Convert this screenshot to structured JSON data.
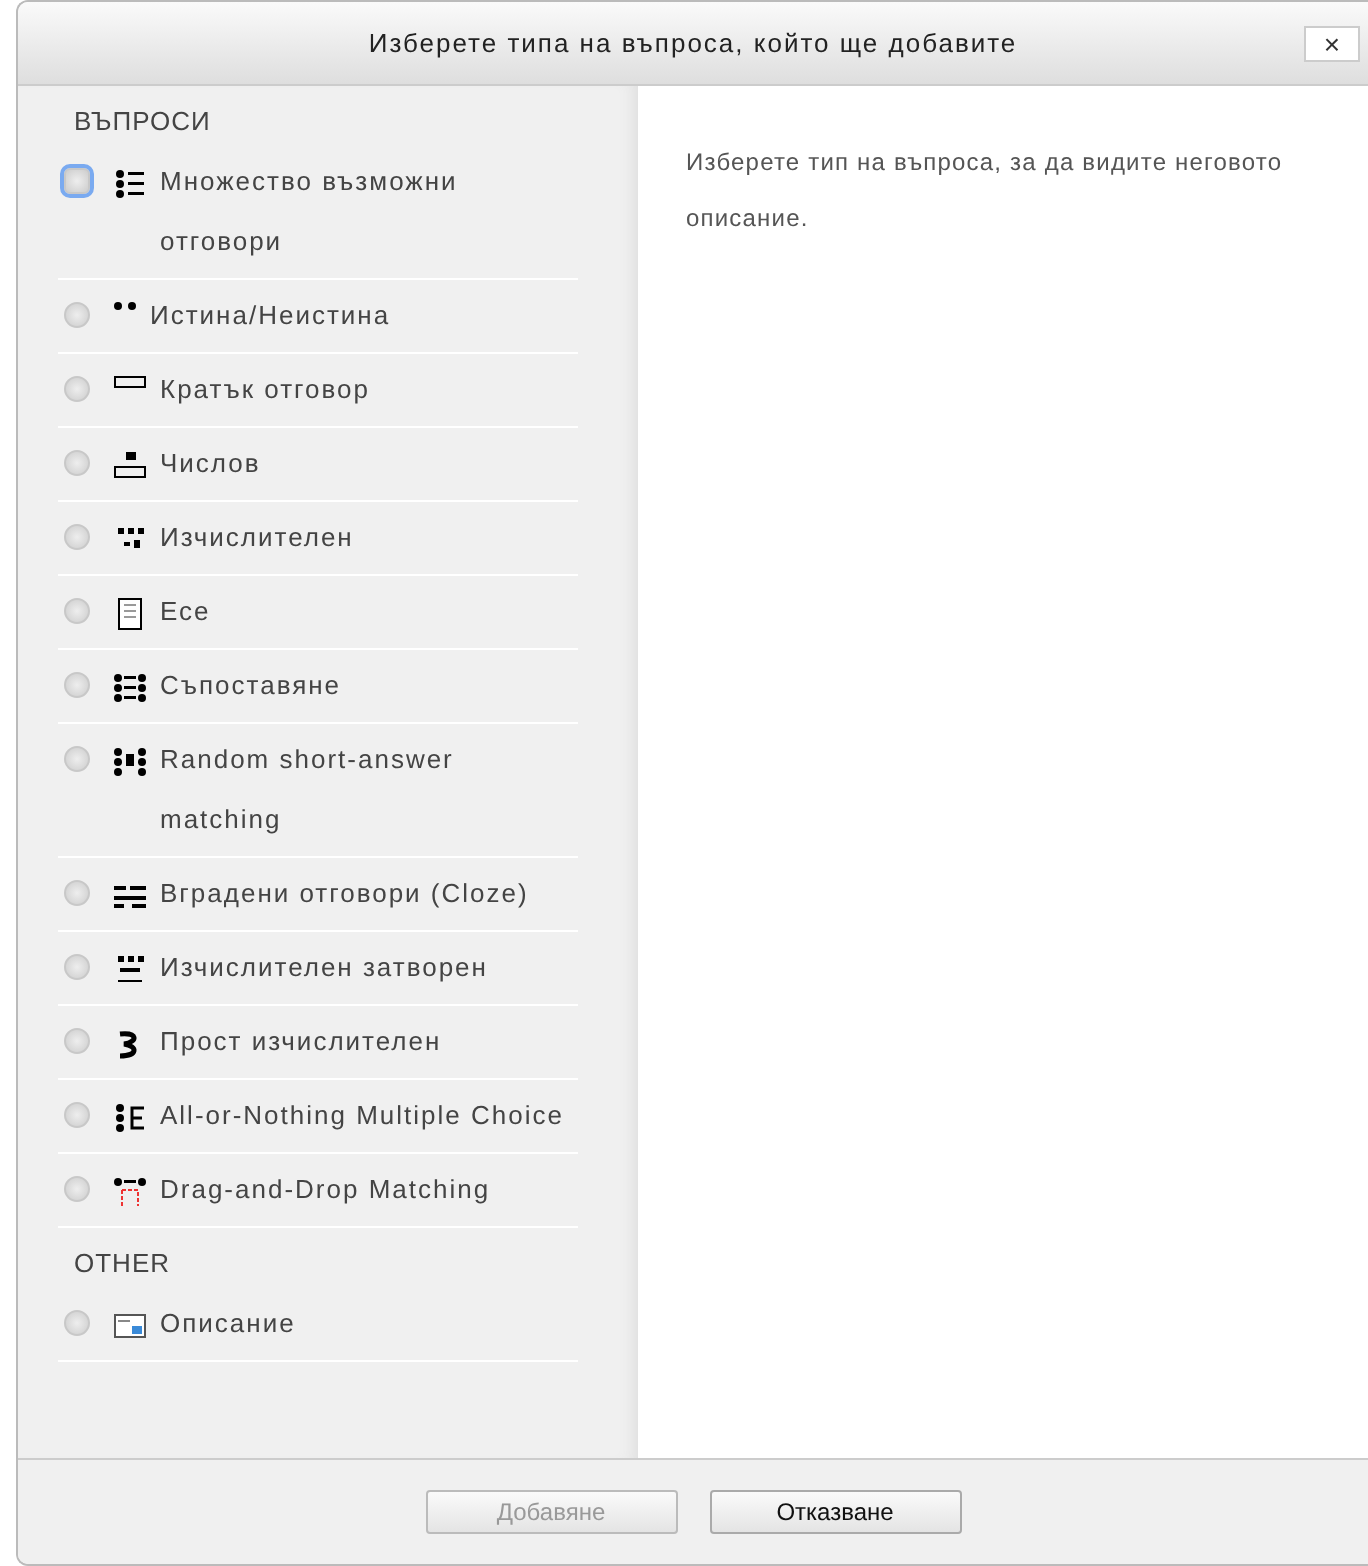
{
  "window": {
    "title": "Изберете типа на въпроса, който ще добавите",
    "close": "×"
  },
  "list": [
    {
      "kind": "section",
      "label": "ВЪПРОСИ"
    },
    {
      "kind": "option",
      "label": "Множество възможни отговори",
      "selected": false,
      "focused": true
    },
    {
      "kind": "option",
      "label": "Истина/Неистина",
      "selected": false,
      "focused": false
    },
    {
      "kind": "option",
      "label": "Кратък отговор",
      "selected": false,
      "focused": false
    },
    {
      "kind": "option",
      "label": "Числов",
      "selected": false,
      "focused": false
    },
    {
      "kind": "option",
      "label": "Изчислителен",
      "selected": false,
      "focused": false
    },
    {
      "kind": "option",
      "label": "Есе",
      "selected": false,
      "focused": false
    },
    {
      "kind": "option",
      "label": "Съпоставяне",
      "selected": false,
      "focused": false
    },
    {
      "kind": "option",
      "label": "Random short-answer matching",
      "selected": false,
      "focused": false
    },
    {
      "kind": "option",
      "label": "Вградени отговори (Cloze)",
      "selected": false,
      "focused": false
    },
    {
      "kind": "option",
      "label": "Изчислителен затворен",
      "selected": false,
      "focused": false
    },
    {
      "kind": "option",
      "label": "Прост изчислителен",
      "selected": false,
      "focused": false
    },
    {
      "kind": "option",
      "label": "All-or-Nothing Multiple Choice",
      "selected": false,
      "focused": false
    },
    {
      "kind": "option",
      "label": "Drag-and-Drop Matching",
      "selected": false,
      "focused": false
    },
    {
      "kind": "section",
      "label": "OTHER"
    },
    {
      "kind": "option",
      "label": "Описание",
      "selected": false,
      "focused": false
    }
  ],
  "description": "Изберете тип на въпроса, за да видите неговото описание.",
  "buttons": [
    {
      "label": "Добавяне",
      "disabled": true
    },
    {
      "label": "Отказване",
      "disabled": false
    }
  ]
}
